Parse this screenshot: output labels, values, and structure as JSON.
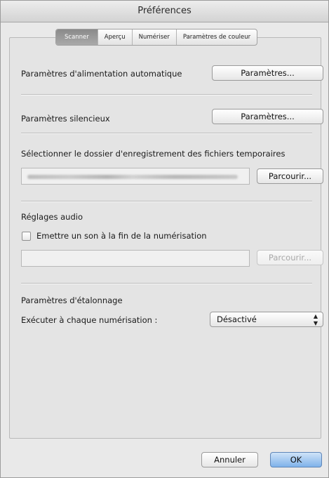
{
  "window": {
    "title": "Préférences"
  },
  "tabs": [
    {
      "label": "Scanner",
      "active": true
    },
    {
      "label": "Aperçu",
      "active": false
    },
    {
      "label": "Numériser",
      "active": false
    },
    {
      "label": "Paramètres de couleur",
      "active": false
    }
  ],
  "auto_feed": {
    "label": "Paramètres d'alimentation automatique",
    "button": "Paramètres..."
  },
  "silent": {
    "label": "Paramètres silencieux",
    "button": "Paramètres..."
  },
  "temp_folder": {
    "label": "Sélectionner le dossier d'enregistrement des fichiers temporaires",
    "browse": "Parcourir..."
  },
  "audio": {
    "heading": "Réglages audio",
    "checkbox_label": "Emettre un son à la fin de la numérisation",
    "checked": false,
    "browse": "Parcourir..."
  },
  "calibration": {
    "heading": "Paramètres d'étalonnage",
    "label": "Exécuter à chaque numérisation :",
    "value": "Désactivé"
  },
  "footer": {
    "cancel": "Annuler",
    "ok": "OK"
  },
  "icons": {
    "select_arrows": "up-down-chevron-icon"
  }
}
